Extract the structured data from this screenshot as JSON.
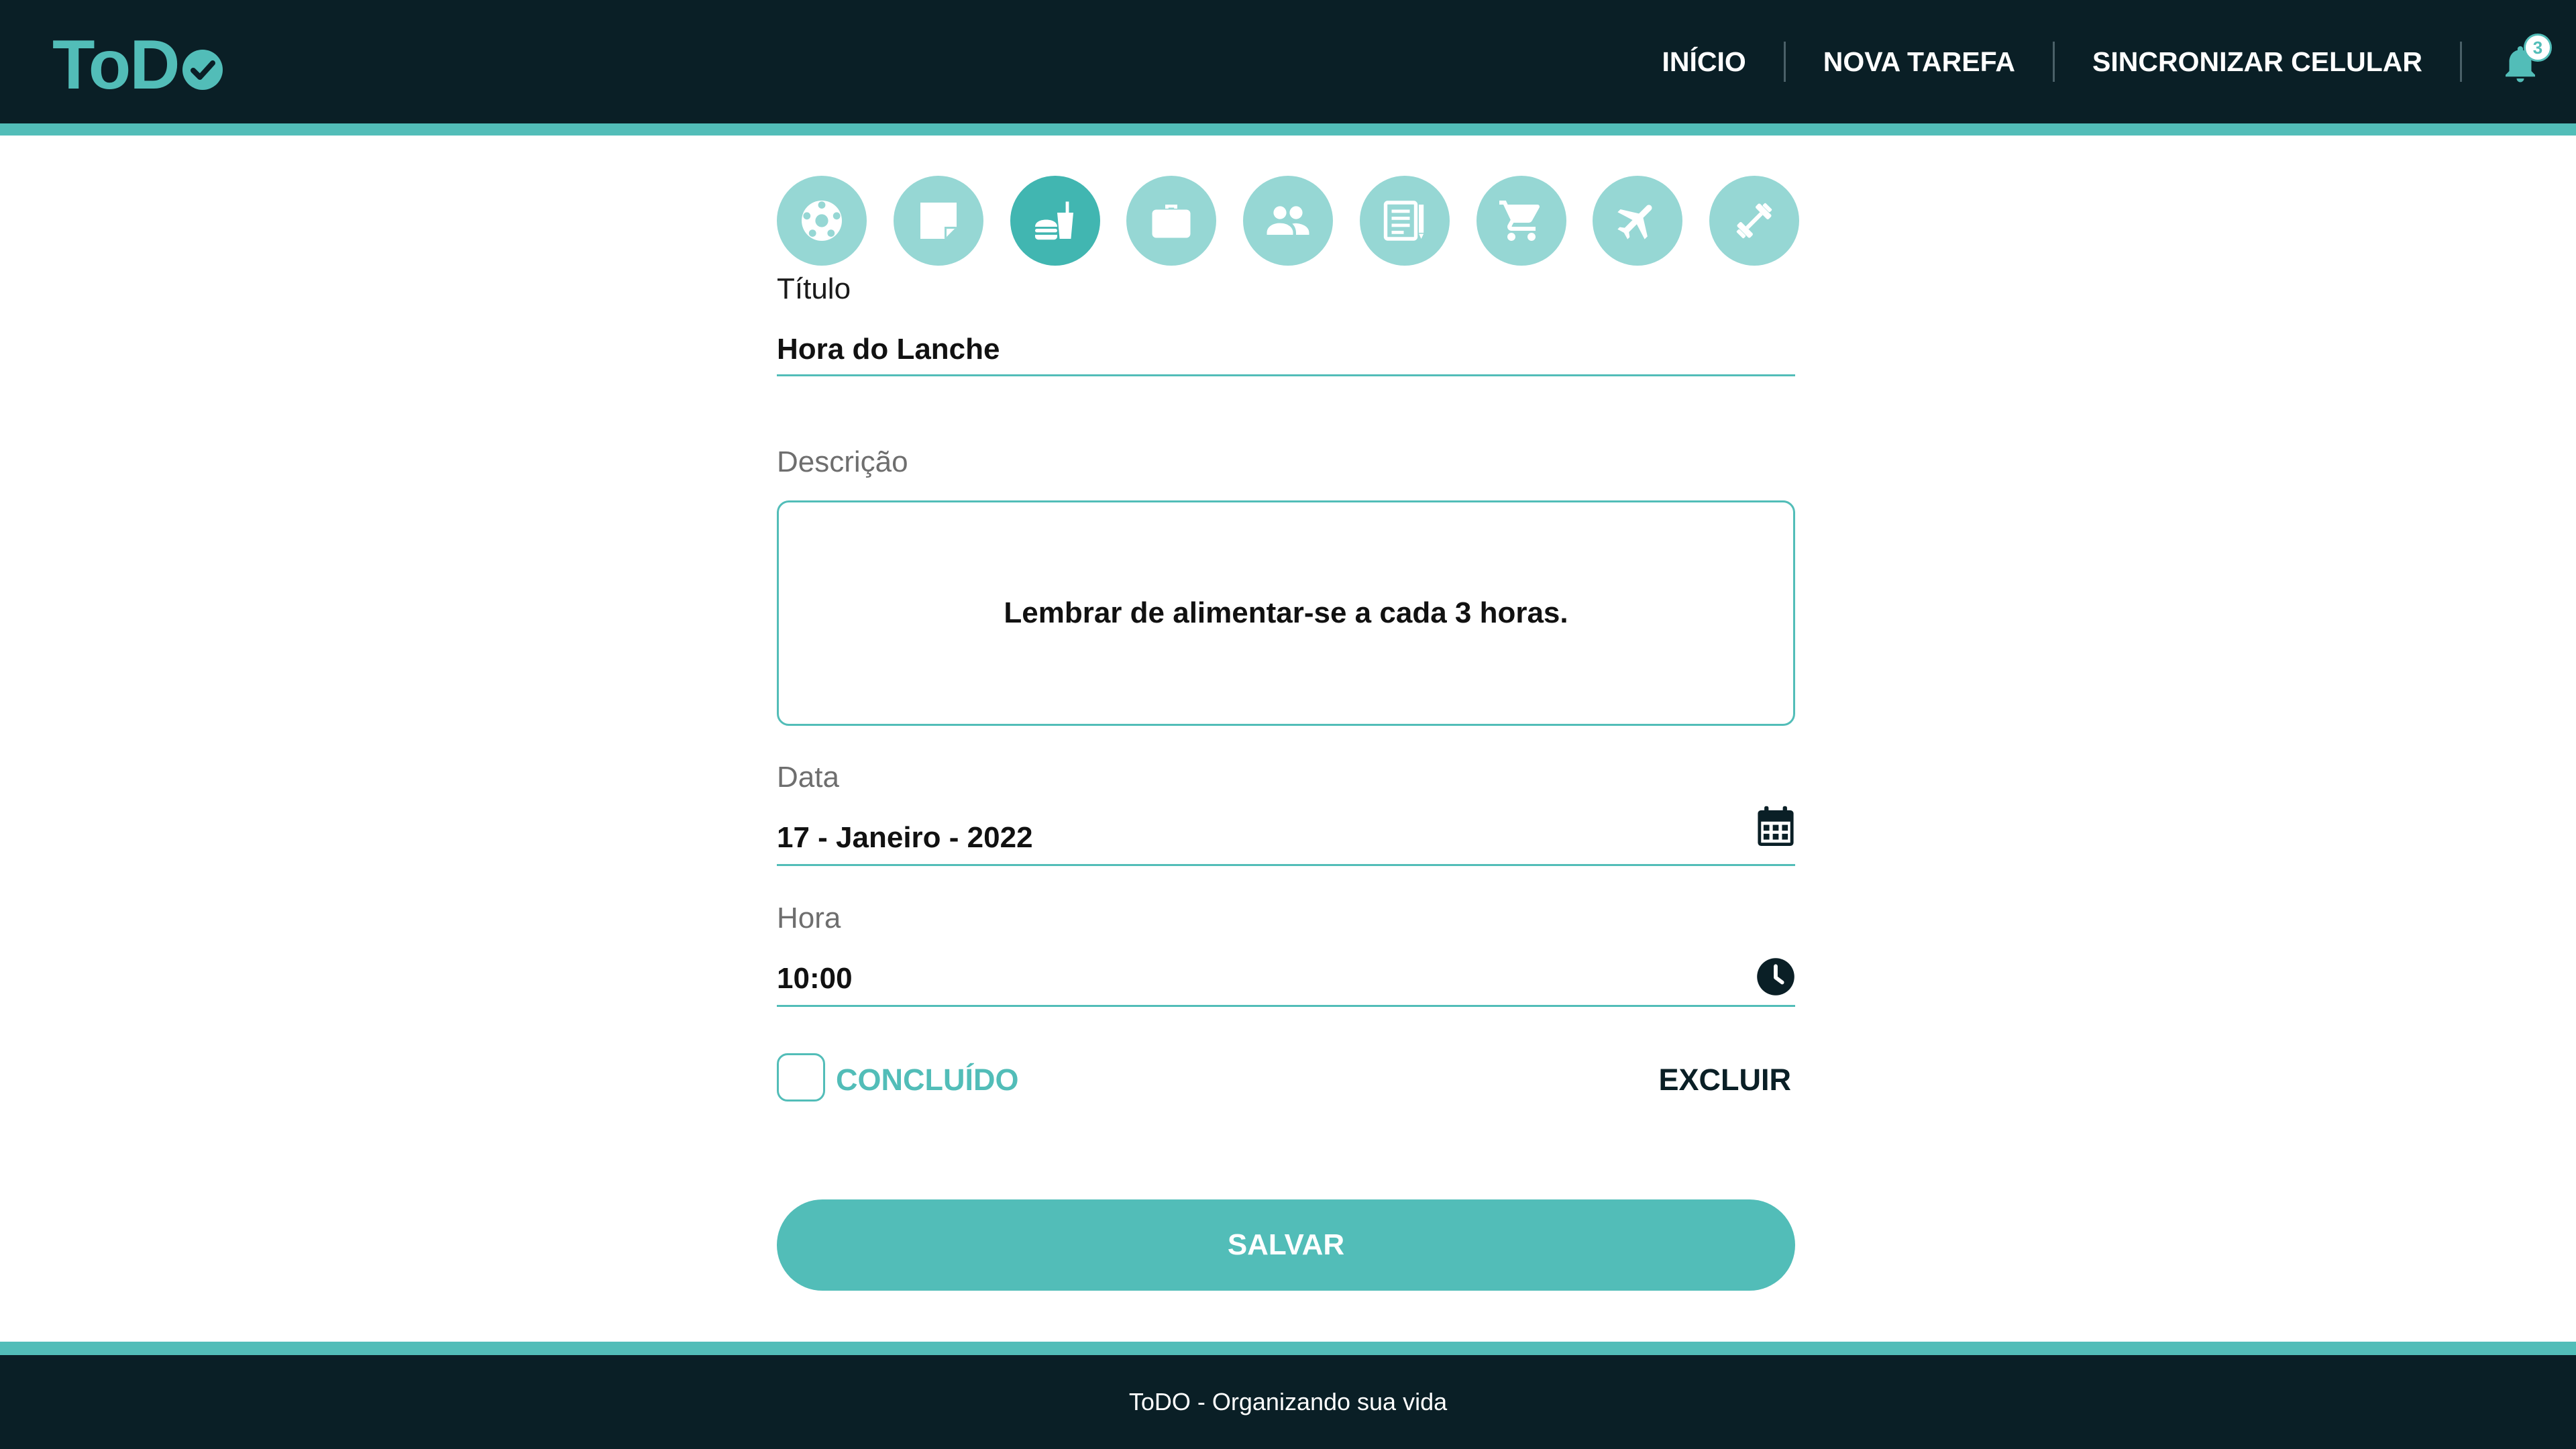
{
  "app": {
    "logo_text": "ToD",
    "logo_mark": "o-check-icon"
  },
  "nav": {
    "items": [
      {
        "label": "INÍCIO"
      },
      {
        "label": "NOVA TAREFA"
      },
      {
        "label": "SINCRONIZAR CELULAR"
      }
    ],
    "notification_count": "3"
  },
  "categories": [
    {
      "icon": "soccer-ball-icon",
      "active": false
    },
    {
      "icon": "sticky-note-icon",
      "active": false
    },
    {
      "icon": "food-drink-icon",
      "active": true
    },
    {
      "icon": "briefcase-icon",
      "active": false
    },
    {
      "icon": "people-icon",
      "active": false
    },
    {
      "icon": "notes-pencil-icon",
      "active": false
    },
    {
      "icon": "shopping-cart-icon",
      "active": false
    },
    {
      "icon": "airplane-icon",
      "active": false
    },
    {
      "icon": "dumbbell-icon",
      "active": false
    }
  ],
  "form": {
    "title_label": "Título",
    "title_value": "Hora do Lanche",
    "description_label": "Descrição",
    "description_value": "Lembrar de alimentar-se a cada 3 horas.",
    "date_label": "Data",
    "date_value": "17 - Janeiro - 2022",
    "time_label": "Hora",
    "time_value": "10:00",
    "done_label": "CONCLUÍDO",
    "done_checked": false,
    "delete_label": "EXCLUIR",
    "save_label": "SALVAR"
  },
  "footer": {
    "text": "ToDO - Organizando sua vida"
  },
  "colors": {
    "dark": "#0a1f26",
    "accent": "#52bdb8",
    "accent_light": "#96d7d4",
    "accent_active": "#41b6b1"
  }
}
